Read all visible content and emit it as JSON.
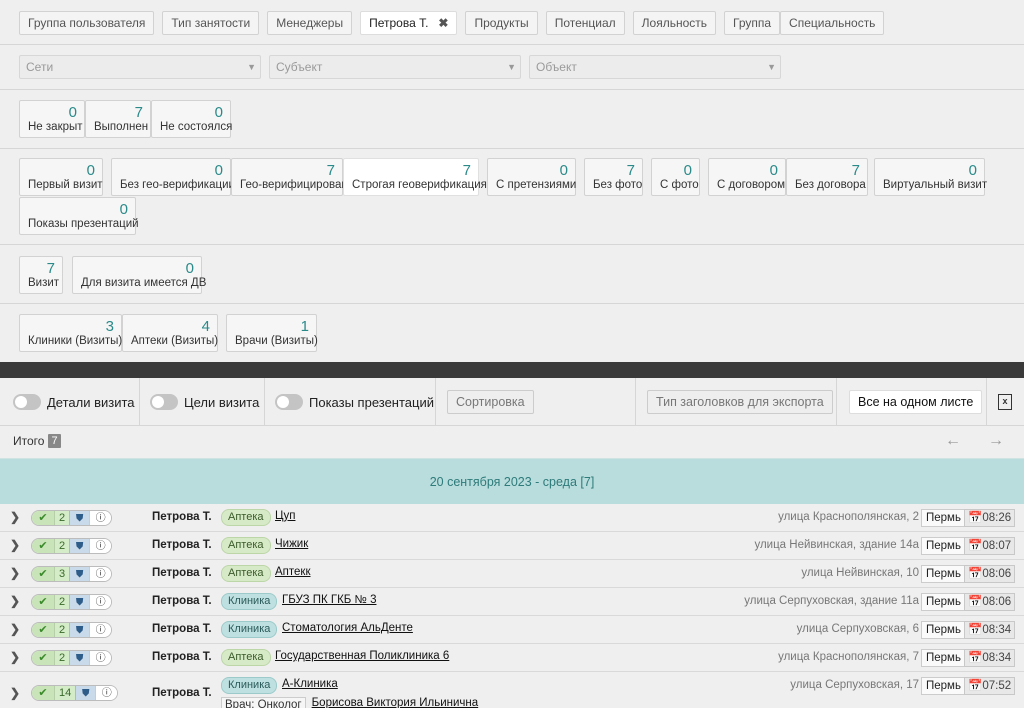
{
  "filter_tabs": [
    {
      "label": "Группа пользователя",
      "active": false
    },
    {
      "label": "Тип занятости",
      "active": false
    },
    {
      "label": "Менеджеры",
      "active": false
    },
    {
      "label": "Петрова Т.",
      "active": true
    },
    {
      "label": "Продукты",
      "active": false
    },
    {
      "label": "Потенциал",
      "active": false
    },
    {
      "label": "Лояльность",
      "active": false
    },
    {
      "label": "Группа",
      "active": false
    },
    {
      "label": "Специальность",
      "active": false
    }
  ],
  "close_glyph": "✖",
  "dropdowns": {
    "networks": "Сети",
    "subject": "Субъект",
    "object": "Объект"
  },
  "status_cards": [
    {
      "value": "0",
      "label": "Не закрыт"
    },
    {
      "value": "7",
      "label": "Выполнен"
    },
    {
      "value": "0",
      "label": "Не состоялся"
    }
  ],
  "verif_cards": [
    {
      "value": "0",
      "label": "Первый визит"
    },
    {
      "value": "0",
      "label": "Без гео-верификации"
    },
    {
      "value": "7",
      "label": "Гео-верифицирован"
    },
    {
      "value": "7",
      "label": "Строгая геоверификация",
      "active": true
    },
    {
      "value": "0",
      "label": "С претензиями"
    },
    {
      "value": "7",
      "label": "Без фото"
    },
    {
      "value": "0",
      "label": "С фото"
    },
    {
      "value": "0",
      "label": "С договором"
    },
    {
      "value": "7",
      "label": "Без договора"
    },
    {
      "value": "0",
      "label": "Виртуальный визит"
    },
    {
      "value": "0",
      "label": "Показы презентаций"
    }
  ],
  "visit_cards": [
    {
      "value": "7",
      "label": "Визит"
    },
    {
      "value": "0",
      "label": "Для визита имеется ДВ"
    }
  ],
  "type_cards": [
    {
      "value": "3",
      "label": "Клиники (Визиты)"
    },
    {
      "value": "4",
      "label": "Аптеки (Визиты)"
    },
    {
      "value": "1",
      "label": "Врачи (Визиты)"
    }
  ],
  "toolbar": {
    "visit_details": "Детали визита",
    "visit_goals": "Цели визита",
    "presentations": "Показы презентаций",
    "sort": "Сортировка",
    "export_header_type": "Тип заголовков для экспорта",
    "all_one_sheet": "Все на одном листе",
    "excel_icon": "x"
  },
  "total": {
    "label": "Итого",
    "count": "7"
  },
  "nav": {
    "prev": "←",
    "next": "→"
  },
  "day_header": "20 сентября 2023 - среда [7]",
  "row_glyphs": {
    "chevron": "❯",
    "check": "✔",
    "shield": "⛊",
    "info": "ⓘ",
    "calendar": "📅"
  },
  "visits": [
    {
      "count": "2",
      "user": "Петрова Т.",
      "type": "Аптека",
      "kind": "ph",
      "org": "Цуп",
      "address": "улица Краснополянская, 2",
      "city": "Пермь",
      "time": "08:26"
    },
    {
      "count": "2",
      "user": "Петрова Т.",
      "type": "Аптека",
      "kind": "ph",
      "org": "Чижик",
      "address": "улица Нейвинская, здание 14а",
      "city": "Пермь",
      "time": "08:07"
    },
    {
      "count": "3",
      "user": "Петрова Т.",
      "type": "Аптека",
      "kind": "ph",
      "org": "Аптекк",
      "address": "улица Нейвинская, 10",
      "city": "Пермь",
      "time": "08:06"
    },
    {
      "count": "2",
      "user": "Петрова Т.",
      "type": "Клиника",
      "kind": "cl",
      "org": "ГБУЗ ПК ГКБ № 3",
      "address": "улица Серпуховская, здание 11а",
      "city": "Пермь",
      "time": "08:06"
    },
    {
      "count": "2",
      "user": "Петрова Т.",
      "type": "Клиника",
      "kind": "cl",
      "org": "Стоматология АльДенте",
      "address": "улица Серпуховская, 6",
      "city": "Пермь",
      "time": "08:34"
    },
    {
      "count": "2",
      "user": "Петрова Т.",
      "type": "Аптека",
      "kind": "ph",
      "org": "Государственная Поликлиника 6",
      "address": "улица Краснополянская, 7",
      "city": "Пермь",
      "time": "08:34"
    },
    {
      "count": "14",
      "user": "Петрова Т.",
      "type": "Клиника",
      "kind": "cl",
      "org": "А-Клиника",
      "address": "улица Серпуховская, 17",
      "city": "Пермь",
      "time": "07:52",
      "doctor_label": "Врач: Онколог",
      "doctor_name": "Борисова Виктория Ильинична"
    }
  ],
  "colors": {
    "accent": "#2a8a8a",
    "day_header_bg": "#b9dcdc",
    "pharmacy_tag": "#d7eac7",
    "clinic_tag": "#bfe0e0"
  }
}
